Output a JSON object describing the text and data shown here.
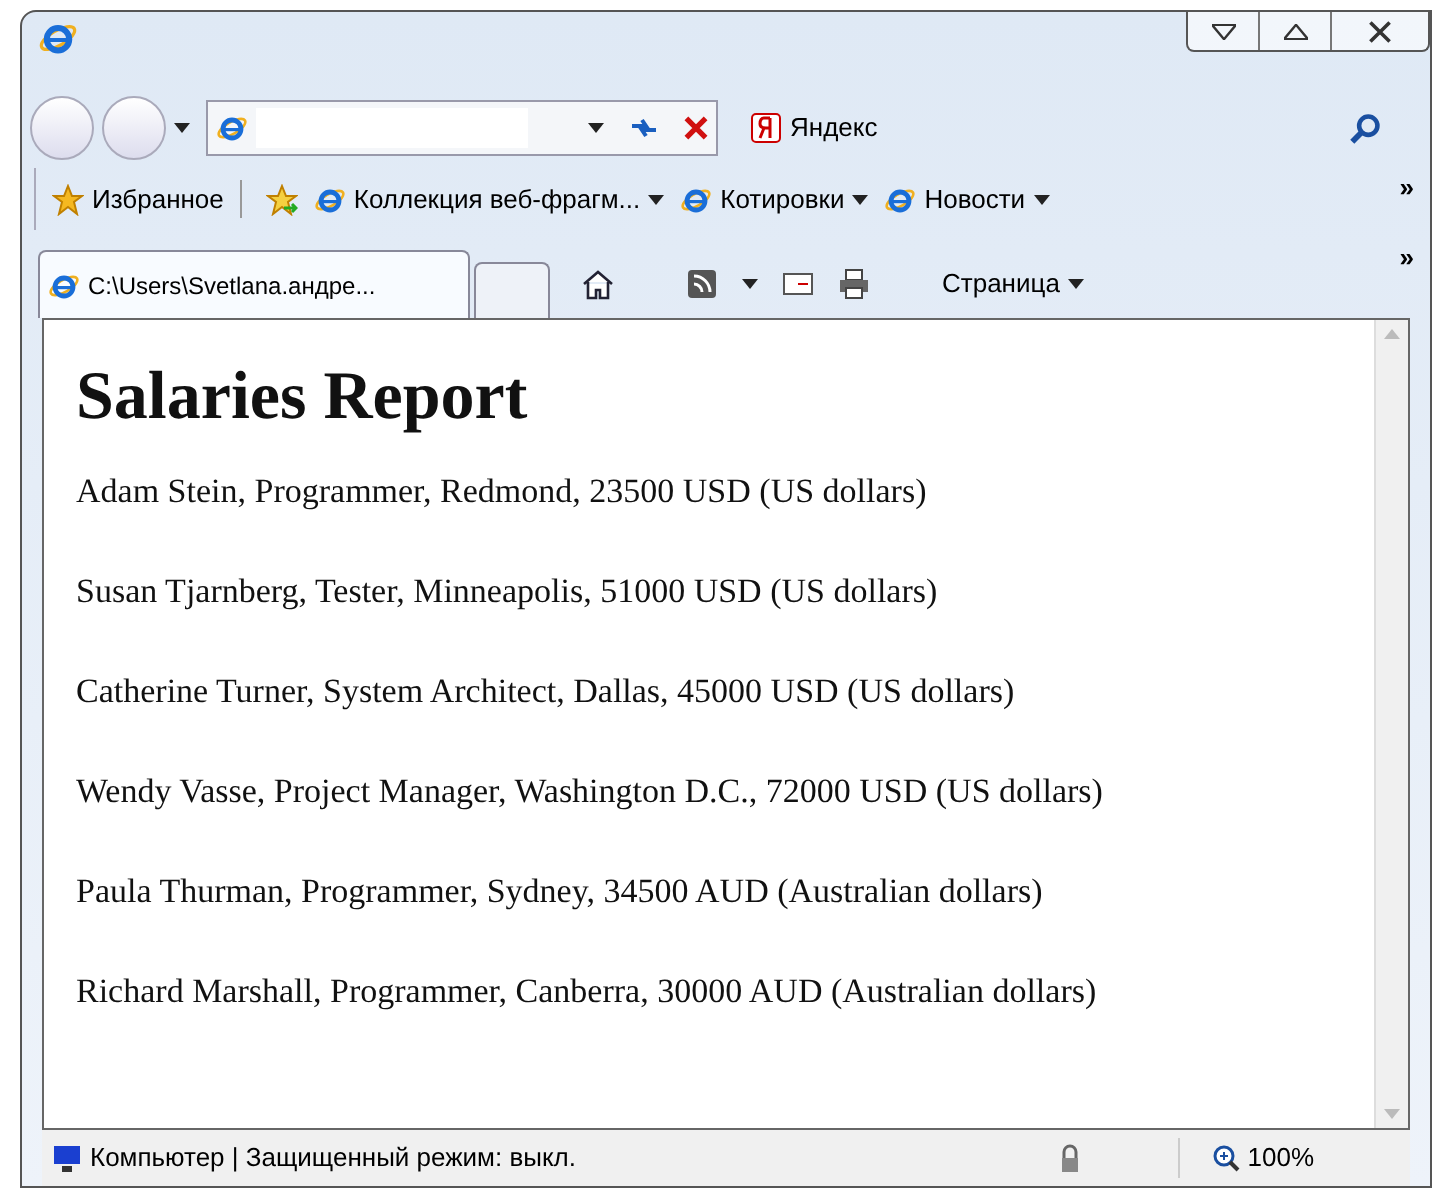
{
  "search_provider": "Яндекс",
  "favorites": {
    "label": "Избранное",
    "links": [
      "Коллекция веб-фрагм...",
      "Котировки",
      "Новости"
    ],
    "more": "»"
  },
  "tab": {
    "title": "C:\\Users\\Svetlana.андре...",
    "selected": true
  },
  "command_bar": {
    "page_menu": "Страница",
    "more": "»"
  },
  "page": {
    "heading": "Salaries Report",
    "rows": [
      "Adam Stein, Programmer, Redmond, 23500 USD (US dollars)",
      "Susan Tjarnberg, Tester, Minneapolis, 51000 USD (US dollars)",
      "Catherine Turner, System Architect, Dallas, 45000 USD (US dollars)",
      "Wendy Vasse, Project Manager, Washington D.C., 72000 USD (US dollars)",
      "Paula Thurman, Programmer, Sydney, 34500 AUD (Australian dollars)",
      "Richard Marshall, Programmer, Canberra, 30000 AUD (Australian dollars)"
    ]
  },
  "status_bar": {
    "zone": "Компьютер | Защищенный режим: выкл.",
    "zoom": "100%"
  }
}
